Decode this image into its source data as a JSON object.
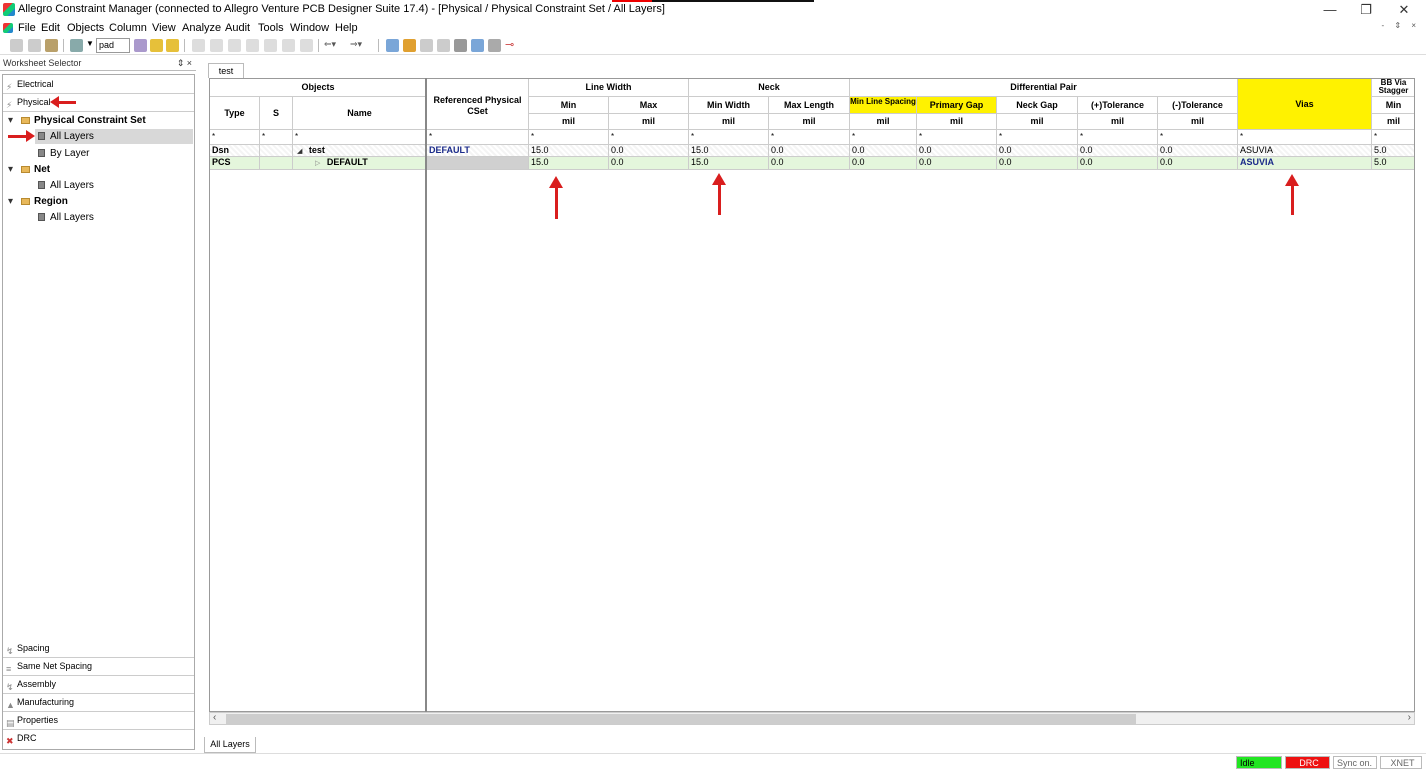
{
  "window": {
    "title": "Allegro Constraint Manager (connected to Allegro Venture PCB Designer Suite 17.4) - [Physical / Physical Constraint Set / All Layers]",
    "minimize": "—",
    "restore": "❐",
    "close": "✕"
  },
  "menu": [
    "File",
    "Edit",
    "Objects",
    "Column",
    "View",
    "Analyze",
    "Audit",
    "Tools",
    "Window",
    "Help"
  ],
  "toolbar": {
    "combo_value": "pad"
  },
  "worksheet": {
    "header": "Worksheet Selector",
    "pin": "⇕ ×",
    "top_categories": [
      "Electrical",
      "Physical"
    ],
    "tree": {
      "pcs": "Physical Constraint Set",
      "pcs_all_layers": "All Layers",
      "pcs_by_layer": "By Layer",
      "net": "Net",
      "net_all_layers": "All Layers",
      "region": "Region",
      "region_all_layers": "All Layers"
    },
    "bottom_categories": [
      "Spacing",
      "Same Net Spacing",
      "Assembly",
      "Manufacturing",
      "Properties",
      "DRC"
    ]
  },
  "tabs": {
    "top": "test",
    "bottom": "All Layers"
  },
  "grid": {
    "group_objects": "Objects",
    "col_type": "Type",
    "col_s": "S",
    "col_name": "Name",
    "col_ref": "Referenced Physical CSet",
    "group_line_width": "Line Width",
    "group_neck": "Neck",
    "group_diff_pair": "Differential Pair",
    "col_vias": "Vias",
    "group_bb": "BB Via Stagger",
    "col_min": "Min",
    "col_max": "Max",
    "col_min_width": "Min Width",
    "col_max_length": "Max Length",
    "col_min_line_spacing": "Min Line Spacing",
    "col_primary_gap": "Primary Gap",
    "col_neck_gap": "Neck Gap",
    "col_plus_tol": "(+)Tolerance",
    "col_minus_tol": "(-)Tolerance",
    "col_bb_min": "Min",
    "unit": "mil",
    "filter": "*",
    "rows": [
      {
        "type": "Dsn",
        "s": "",
        "name": "test",
        "ref": "DEFAULT",
        "values": [
          "15.0",
          "0.0",
          "15.0",
          "0.0",
          "0.0",
          "0.0",
          "0.0",
          "0.0",
          "0.0"
        ],
        "vias": "ASUVIA",
        "bb_min": "5.0"
      },
      {
        "type": "PCS",
        "s": "",
        "name": "DEFAULT",
        "ref": "",
        "values": [
          "15.0",
          "0.0",
          "15.0",
          "0.0",
          "0.0",
          "0.0",
          "0.0",
          "0.0",
          "0.0"
        ],
        "vias": "ASUVIA",
        "bb_min": "5.0"
      }
    ]
  },
  "status": {
    "idle": "Idle",
    "drc": "DRC",
    "sync": "Sync on.",
    "xnet": "XNET"
  },
  "colors": {
    "highlight_yellow": "#fff200",
    "annotation_red": "#d91e1e",
    "pcs_row": "#e4f6dc",
    "idle_green": "#22e622",
    "drc_red": "#ee1111"
  }
}
